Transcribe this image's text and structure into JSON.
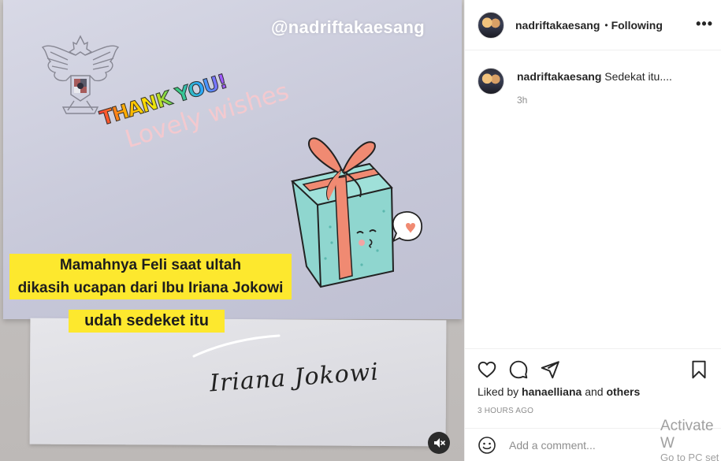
{
  "media": {
    "watermark": "@nadriftakaesang",
    "sticker_thankyou": "THANK YOU!",
    "sticker_lovely": "Lovely wishes",
    "caption_line1": "Mamahnya Feli saat ultah",
    "caption_line2": "dikasih ucapan dari Ibu Iriana Jokowi",
    "caption_short": "udah sedeket itu",
    "signature": "Iriana Jokowi",
    "mute_icon": "muted-speaker-icon"
  },
  "header": {
    "username": "nadriftakaesang",
    "separator": "•",
    "follow_status": "Following",
    "more_icon": "more-options-icon"
  },
  "comment": {
    "username": "nadriftakaesang",
    "text": "Sedekat itu....",
    "time": "3h"
  },
  "actions": {
    "icons": [
      "heart-icon",
      "comment-icon",
      "share-icon",
      "bookmark-icon"
    ],
    "liked_by_prefix": "Liked by",
    "liked_by_user": "hanaelliana",
    "liked_by_and": "and",
    "liked_by_others": "others",
    "posted_ago": "3 HOURS AGO"
  },
  "comment_box": {
    "placeholder": "Add a comment...",
    "emoji_icon": "emoji-icon"
  },
  "watermark_os": {
    "line1": "Activate W",
    "line2": "Go to PC set"
  },
  "colors": {
    "caption_bg": "#fde82e",
    "gift_box": "#8fd6cf",
    "ribbon": "#f08a72",
    "text_primary": "#262626",
    "text_secondary": "#8e8e8e"
  }
}
